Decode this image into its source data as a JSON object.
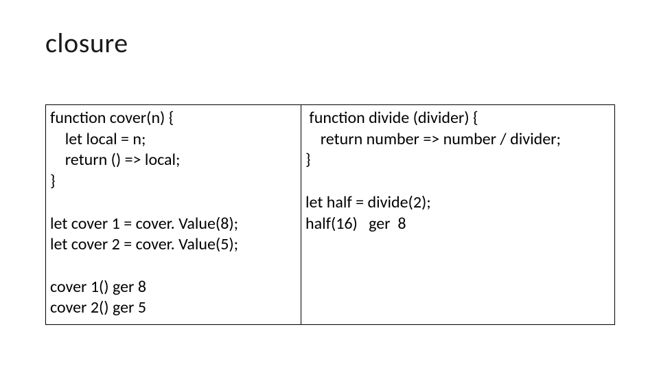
{
  "title": "closure",
  "left": {
    "lines": [
      "function cover(n) {",
      "    let local = n;",
      "    return () => local;",
      "}",
      "",
      "let cover 1 = cover. Value(8);",
      "let cover 2 = cover. Value(5);",
      "",
      "cover 1() ger 8",
      "cover 2() ger 5"
    ]
  },
  "right": {
    "lines": [
      " function divide (divider) {",
      "    return number => number / divider;",
      "}",
      "",
      "let half = divide(2);",
      "half(16)   ger  8"
    ]
  }
}
